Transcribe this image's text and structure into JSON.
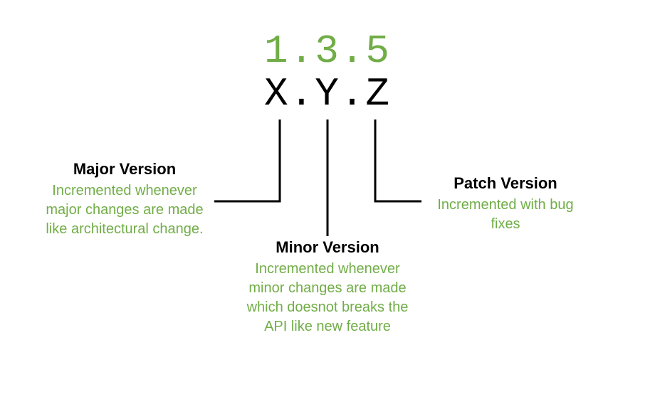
{
  "version": {
    "example": "1.3.5",
    "template": "X.Y.Z"
  },
  "sections": {
    "major": {
      "title": "Major Version",
      "desc": "Incremented whenever major changes are made like architectural change."
    },
    "minor": {
      "title": "Minor Version",
      "desc": "Incremented whenever minor changes are made which doesnot breaks the API like new feature"
    },
    "patch": {
      "title": "Patch Version",
      "desc": "Incremented with bug fixes"
    }
  },
  "colors": {
    "accent": "#71ad47",
    "text": "#000000"
  }
}
